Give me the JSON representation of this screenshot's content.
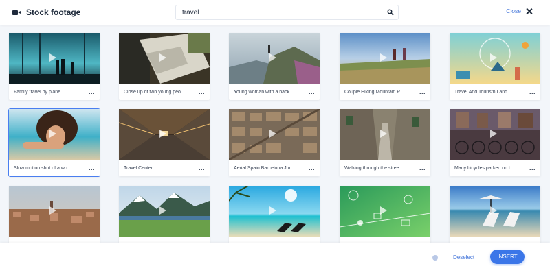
{
  "header": {
    "title": "Stock footage",
    "search_value": "travel",
    "close_label": "Close"
  },
  "colors": {
    "accent": "#3b76e8",
    "selected_outline": "#4a7ef0",
    "background": "#f3f6fa"
  },
  "clips": [
    {
      "label": "Family travel by plane",
      "selected": false
    },
    {
      "label": "Close up of two young peo...",
      "selected": false
    },
    {
      "label": "Young woman with a back...",
      "selected": false
    },
    {
      "label": "Couple Hiking Mountain P...",
      "selected": false
    },
    {
      "label": "Travel And Tourism Land...",
      "selected": false
    },
    {
      "label": "Slow motion shot of a wo...",
      "selected": true
    },
    {
      "label": "Travel Center",
      "selected": false
    },
    {
      "label": "Aerial Spain Barcelona Jun...",
      "selected": false
    },
    {
      "label": "Walking through the stree...",
      "selected": false
    },
    {
      "label": "Many bicycles parked on t...",
      "selected": false
    },
    {
      "label": "",
      "selected": false
    },
    {
      "label": "",
      "selected": false
    },
    {
      "label": "",
      "selected": false
    },
    {
      "label": "",
      "selected": false
    },
    {
      "label": "",
      "selected": false
    }
  ],
  "more_label": "...",
  "footer": {
    "deselect_label": "Deselect",
    "insert_label": "INSERT"
  }
}
